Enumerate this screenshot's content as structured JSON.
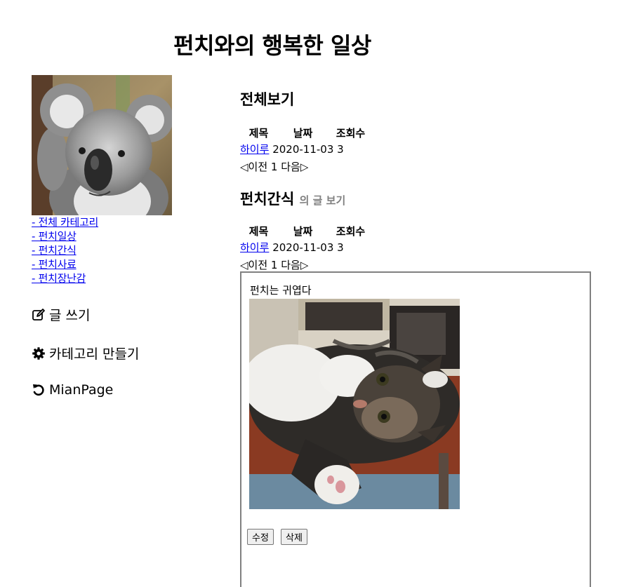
{
  "site": {
    "title": "펀치와의 행복한 일상"
  },
  "sidebar": {
    "categories": [
      {
        "label": "- 전체 카테고리"
      },
      {
        "label": "- 펀치일상"
      },
      {
        "label": "- 펀치간식"
      },
      {
        "label": "- 펀치사료"
      },
      {
        "label": "- 펀치장난감"
      }
    ],
    "actions": {
      "write": {
        "label": "글 쓰기",
        "icon": "pencil-square-icon"
      },
      "make_category": {
        "label": "카테고리 만들기",
        "icon": "gear-icon"
      },
      "main_page": {
        "label": "MianPage",
        "icon": "undo-arrow-icon"
      }
    }
  },
  "all_posts": {
    "heading": "전체보기",
    "columns": [
      "제목",
      "날짜",
      "조회수"
    ],
    "rows": [
      {
        "title": "하이루",
        "date": "2020-11-03",
        "views": "3"
      }
    ],
    "pager": {
      "prev": "◁이전",
      "page": "1",
      "next": "다음▷"
    }
  },
  "category_posts": {
    "heading": "펀치간식",
    "heading_suffix": "의 글 보기",
    "columns": [
      "제목",
      "날짜",
      "조회수"
    ],
    "rows": [
      {
        "title": "하이루",
        "date": "2020-11-03",
        "views": "3"
      }
    ],
    "pager": {
      "prev": "◁이전",
      "page": "1",
      "next": "다음▷"
    }
  },
  "post": {
    "content": "펀치는 귀엽다",
    "edit_label": "수정",
    "delete_label": "삭제"
  },
  "colors": {
    "link": "#0000ee",
    "box_border": "#808080",
    "suffix_text": "#808080"
  }
}
